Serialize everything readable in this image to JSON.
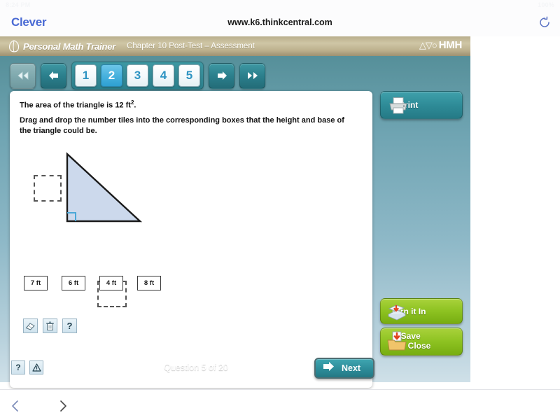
{
  "browser": {
    "status_time": "8:24 PM",
    "status_date": "Thu Mar 18",
    "status_right": "100%",
    "clever_label": "Clever",
    "url": "www.k6.thinkcentral.com",
    "reload_icon": "reload-icon",
    "back_icon": "chevron-left-icon",
    "forward_icon": "chevron-right-icon"
  },
  "header": {
    "app_icon": "shell-leaf-icon",
    "app_title": "Personal Math Trainer",
    "chapter_title": "Chapter 10 Post-Test – Assessment",
    "brand_marks": "△▽○",
    "brand_text": "HMH",
    "bar_color": "#c4b995"
  },
  "nav": {
    "first_label": "first-page",
    "prev_label": "previous-page",
    "next_label": "next-page",
    "last_label": "last-page",
    "pages": [
      {
        "label": "1",
        "active": false
      },
      {
        "label": "2",
        "active": true
      },
      {
        "label": "3",
        "active": false
      },
      {
        "label": "4",
        "active": false
      },
      {
        "label": "5",
        "active": false
      }
    ],
    "active_color": "#45b0dd",
    "inactive_text_color": "#2e94c2"
  },
  "question": {
    "statement_prefix": "The area of the triangle is 12 ft",
    "statement_exponent": "2",
    "statement_suffix": ".",
    "instruction": "Drag and drop the number tiles into the corresponding boxes that the height and base of the triangle could be.",
    "figure": {
      "shape": "right-triangle",
      "fill_color": "#ccd9ec",
      "stroke_color": "#1a1a1a",
      "right_angle_color": "#4aa8d8",
      "drop_boxes": [
        {
          "name": "height-drop-box",
          "value": ""
        },
        {
          "name": "base-drop-box",
          "value": ""
        }
      ]
    },
    "tiles": [
      {
        "label": "7 ft"
      },
      {
        "label": "6 ft"
      },
      {
        "label": "4 ft"
      },
      {
        "label": "8 ft"
      }
    ],
    "tools": [
      {
        "name": "eraser-icon"
      },
      {
        "name": "trash-icon"
      },
      {
        "name": "help-icon",
        "glyph": "?"
      }
    ]
  },
  "sidebar": {
    "print_label": "Print",
    "turn_in_label": "Turn it In",
    "save_close_line1": "Save",
    "save_close_line2": "and Close",
    "green_color": "#8dc221",
    "teal_color": "#2e8b97"
  },
  "footer": {
    "help_glyph": "?",
    "warning_glyph": "⚠",
    "question_counter": "Question 5 of 20",
    "next_label": "Next"
  }
}
